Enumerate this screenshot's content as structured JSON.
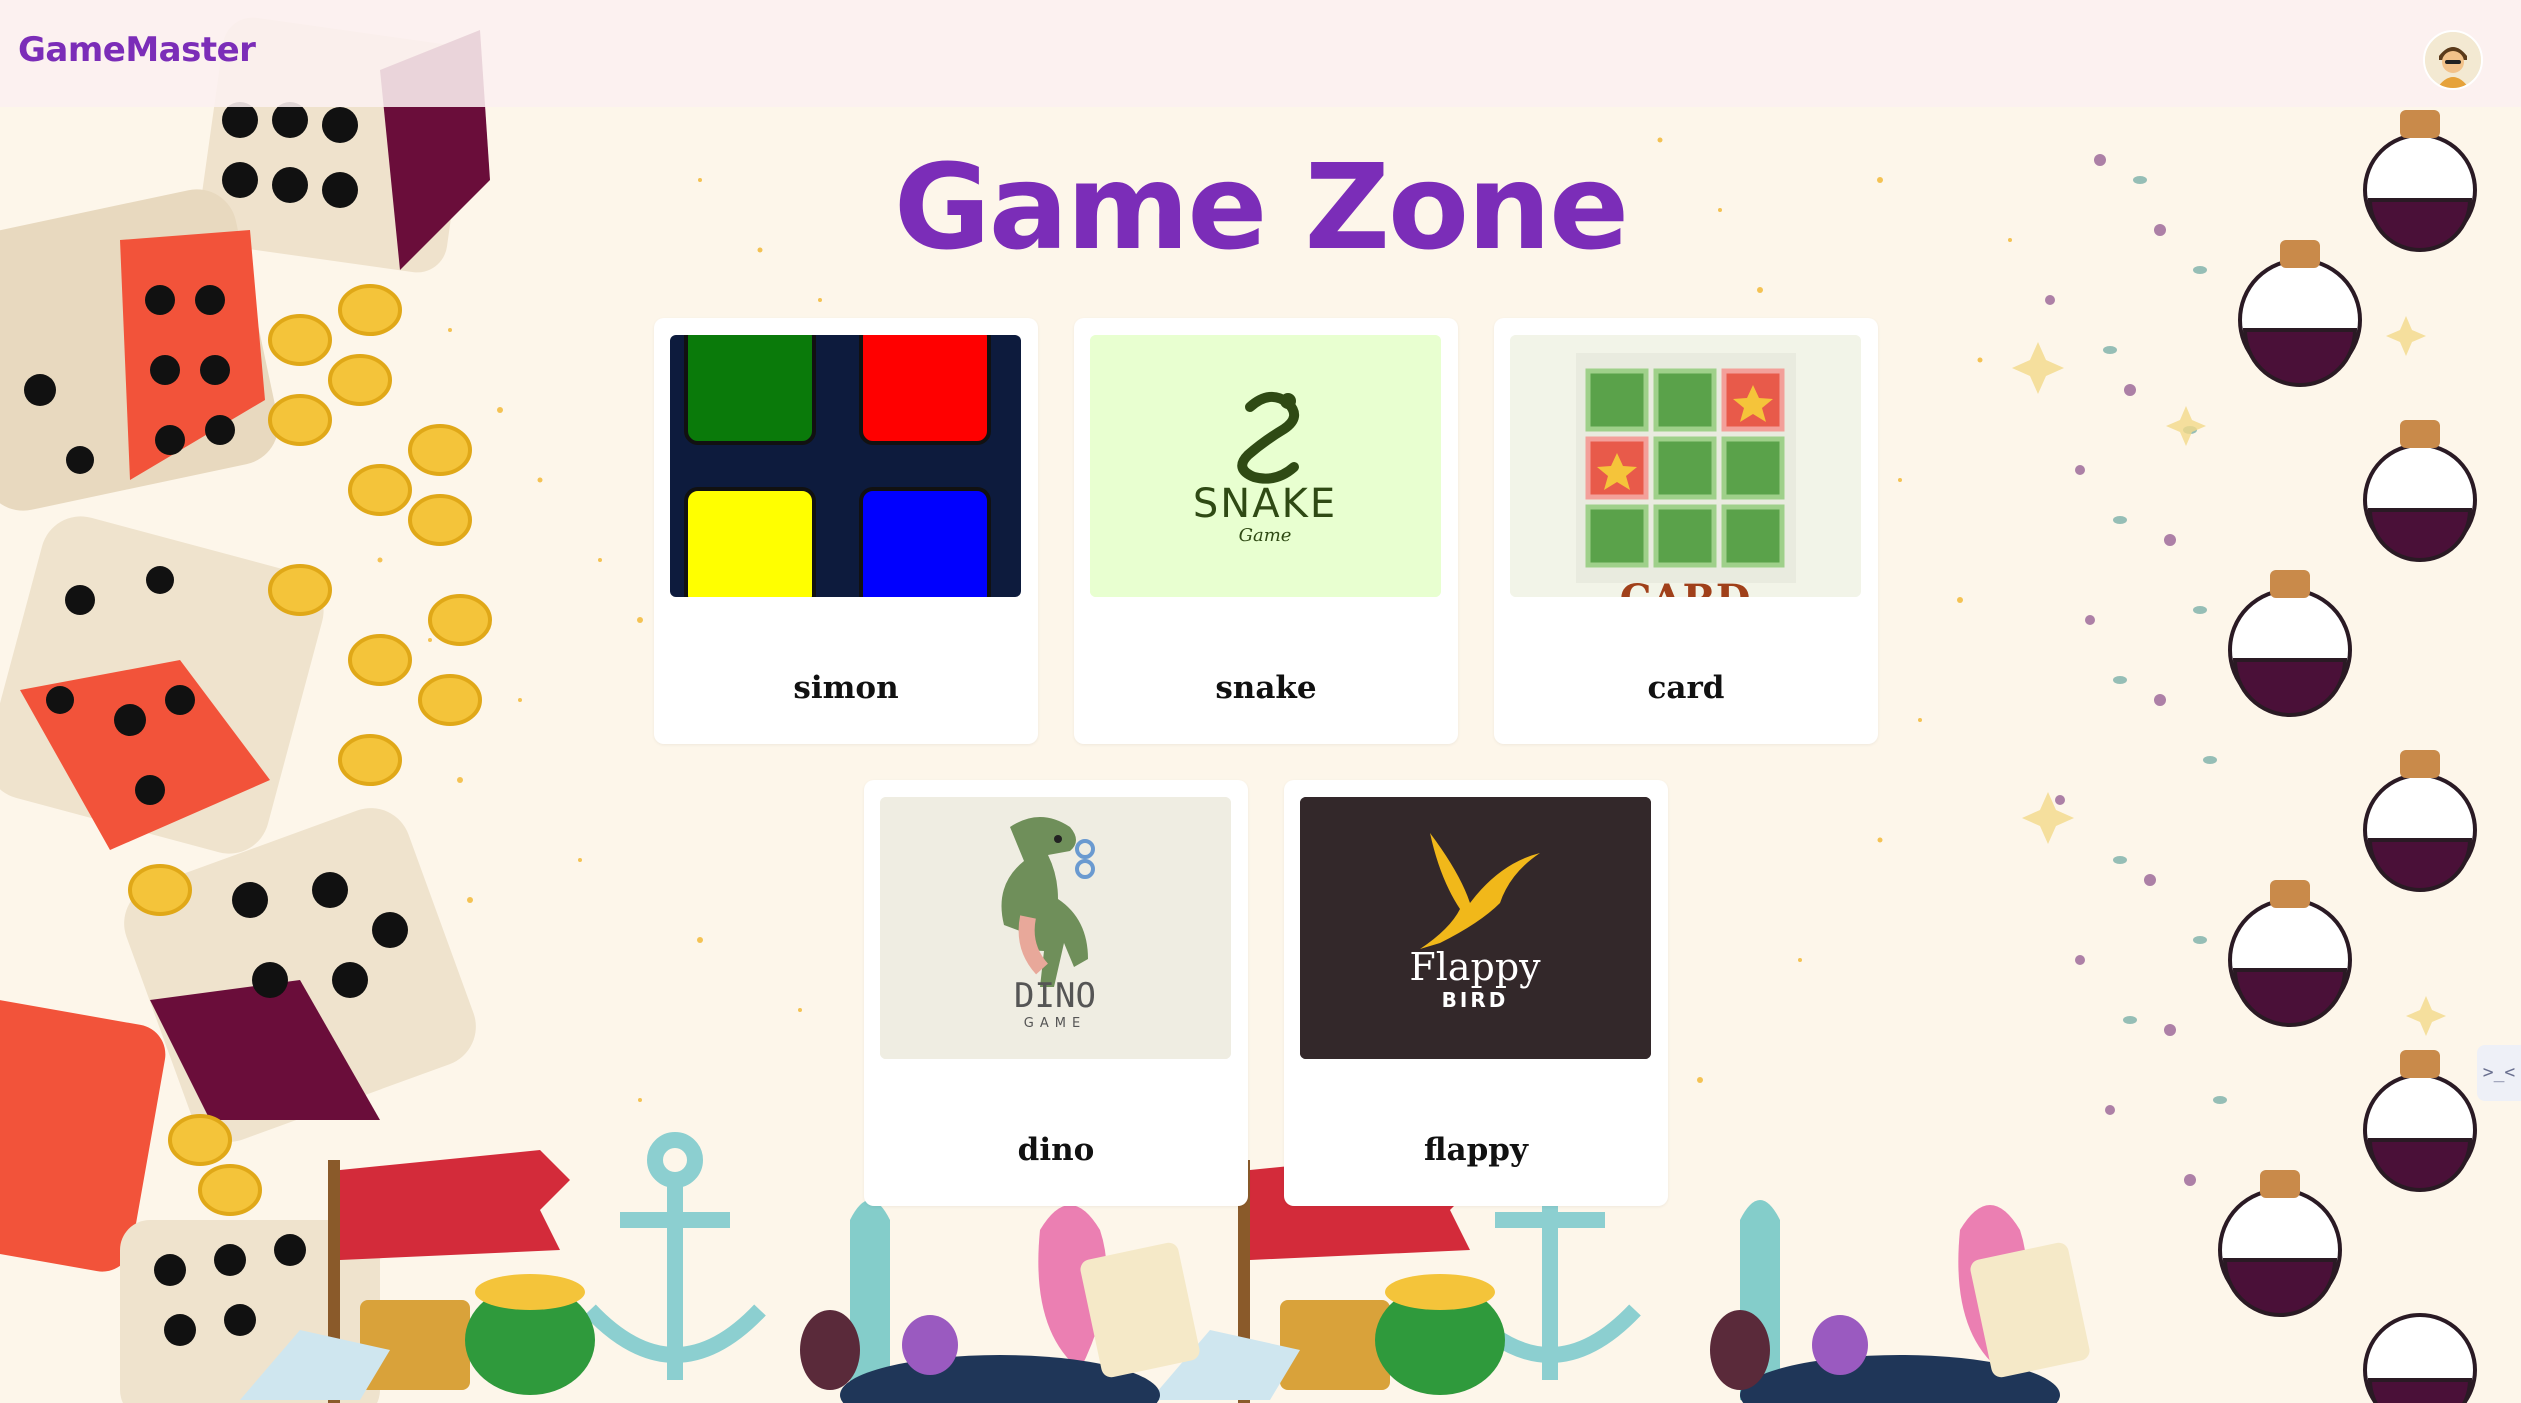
{
  "navbar": {
    "brand": "GameMaster",
    "avatar_icon": "avatar-icon"
  },
  "page": {
    "title": "Game Zone"
  },
  "games": [
    {
      "label": "simon",
      "thumb_icon": "simon-thumbnail"
    },
    {
      "label": "snake",
      "thumb_icon": "snake-thumbnail",
      "thumb_title": "SNAKE",
      "thumb_sub": "Game"
    },
    {
      "label": "card",
      "thumb_icon": "card-thumbnail",
      "thumb_title": "CARD"
    },
    {
      "label": "dino",
      "thumb_icon": "dino-thumbnail",
      "thumb_title": "DINO",
      "thumb_sub": "GAME"
    },
    {
      "label": "flappy",
      "thumb_icon": "flappy-thumbnail",
      "thumb_title": "Flappy",
      "thumb_sub": "BIRD"
    }
  ],
  "side_tab": {
    "glyph": ">_<",
    "icon": "side-tab-icon"
  },
  "colors": {
    "brand": "#7b2db8",
    "background": "#fdf6ea"
  }
}
